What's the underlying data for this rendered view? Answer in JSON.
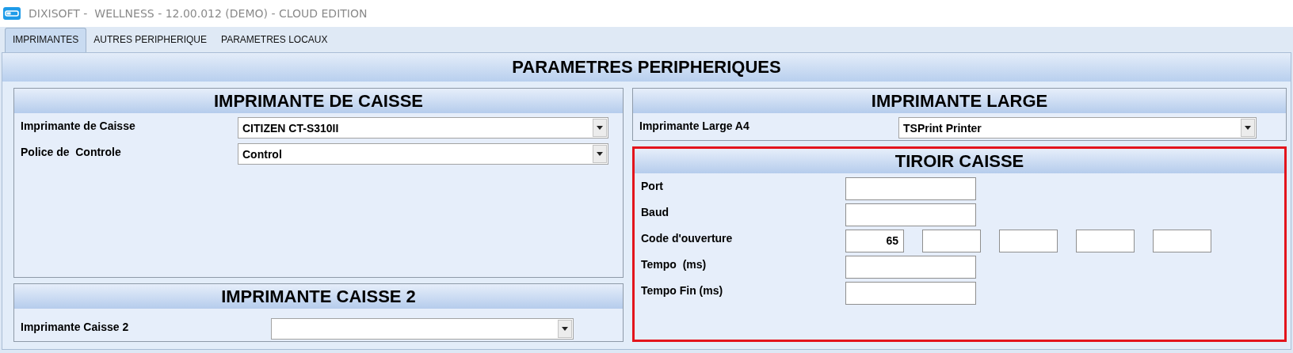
{
  "window": {
    "title": "DIXISOFT -  WELLNESS - 12.00.012 (DEMO) - CLOUD EDITION"
  },
  "tabs": [
    {
      "label": "IMPRIMANTES",
      "selected": true
    },
    {
      "label": "AUTRES PERIPHERIQUE",
      "selected": false
    },
    {
      "label": "PARAMETRES LOCAUX",
      "selected": false
    }
  ],
  "page_title": "PARAMETRES PERIPHERIQUES",
  "left_column": [
    {
      "title": "IMPRIMANTE DE CAISSE",
      "highlighted": false,
      "rows": [
        {
          "kind": "dropdown",
          "label": "Imprimante de Caisse",
          "value": "CITIZEN CT-S310II"
        },
        {
          "kind": "dropdown",
          "label": "Police de  Controle",
          "value": "Control"
        }
      ]
    },
    {
      "title": "IMPRIMANTE CAISSE 2",
      "highlighted": false,
      "rows": [
        {
          "kind": "dropdown",
          "label": "Imprimante Caisse 2"
        }
      ]
    }
  ],
  "right_column": [
    {
      "title": "IMPRIMANTE LARGE",
      "highlighted": false,
      "rows": [
        {
          "kind": "dropdown",
          "label": "Imprimante Large A4",
          "value": "TSPrint Printer"
        }
      ]
    },
    {
      "title": "TIROIR CAISSE",
      "highlighted": true,
      "rows": [
        {
          "kind": "text",
          "label": "Port"
        },
        {
          "kind": "text",
          "label": "Baud"
        },
        {
          "kind": "multi",
          "label": "Code d'ouverture",
          "boxes": [
            {
              "kind": "input",
              "value": "65"
            },
            {
              "kind": "input"
            },
            {
              "kind": "input"
            },
            {
              "kind": "input"
            },
            {
              "kind": "input"
            }
          ]
        },
        {
          "kind": "text",
          "label": "Tempo  (ms)"
        },
        {
          "kind": "text",
          "label": "Tempo Fin (ms)"
        }
      ]
    }
  ]
}
